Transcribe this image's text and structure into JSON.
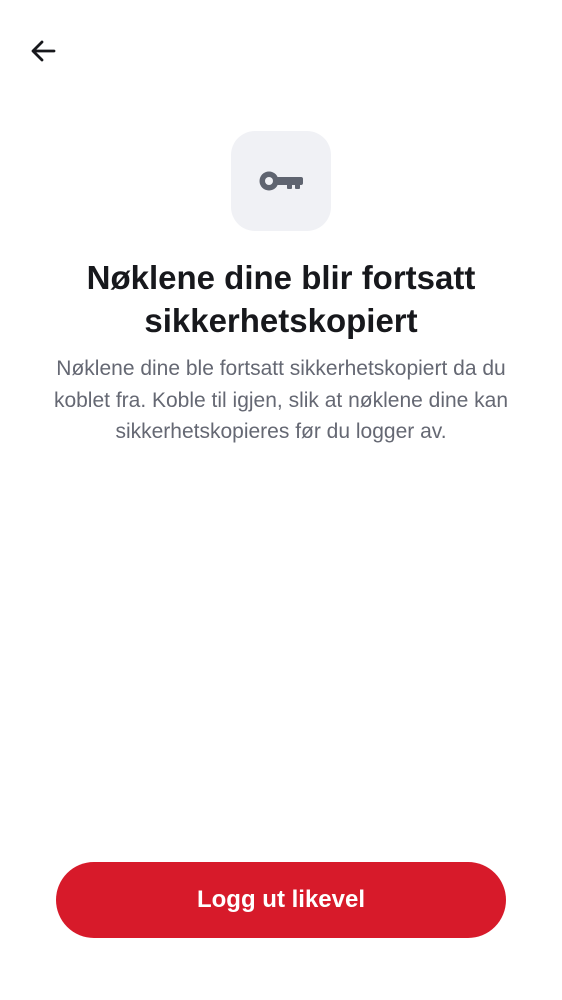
{
  "header": {
    "back_icon": "arrow-left-icon"
  },
  "hero": {
    "icon": "key-icon"
  },
  "content": {
    "title": "Nøklene dine blir fortsatt sikkerhetskopiert",
    "description": "Nøklene dine ble fortsatt sikkerhetskopiert da du koblet fra. Koble til igjen, slik at nøklene dine kan sikkerhetskopieres før du logger av."
  },
  "actions": {
    "logout_label": "Logg ut likevel"
  },
  "colors": {
    "accent": "#d71a2a",
    "title": "#17181c",
    "body_text": "#656873",
    "icon_tile_bg": "#f0f1f5",
    "icon": "#5f6470"
  }
}
